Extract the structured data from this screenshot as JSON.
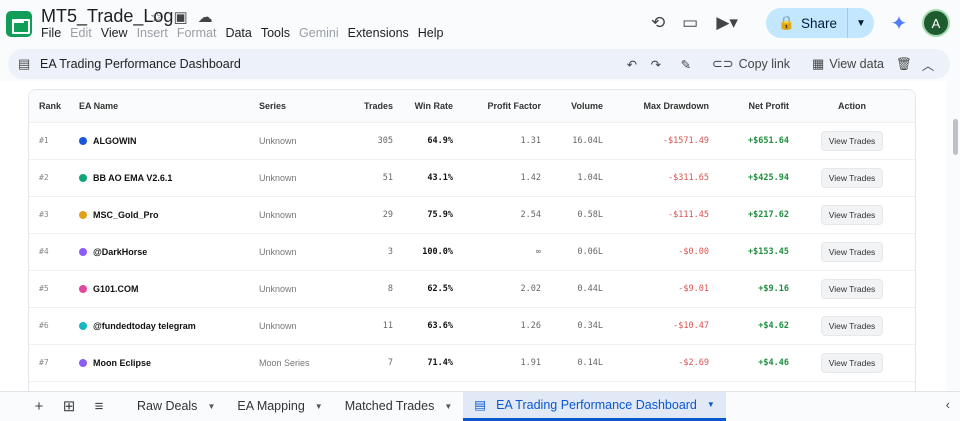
{
  "app": {
    "doc_title": "MT5_Trade_Log",
    "menu": [
      {
        "label": "File",
        "disabled": false
      },
      {
        "label": "Edit",
        "disabled": true
      },
      {
        "label": "View",
        "disabled": false
      },
      {
        "label": "Insert",
        "disabled": true
      },
      {
        "label": "Format",
        "disabled": true
      },
      {
        "label": "Data",
        "disabled": false
      },
      {
        "label": "Tools",
        "disabled": false
      },
      {
        "label": "Gemini",
        "disabled": true
      },
      {
        "label": "Extensions",
        "disabled": false
      },
      {
        "label": "Help",
        "disabled": false
      }
    ],
    "share_label": "Share",
    "avatar_initial": "A"
  },
  "dashboard": {
    "title": "EA Trading Performance Dashboard",
    "copy_link": "Copy link",
    "view_data": "View data"
  },
  "table": {
    "headers": [
      "Rank",
      "EA Name",
      "Series",
      "Trades",
      "Win Rate",
      "Profit Factor",
      "Volume",
      "Max Drawdown",
      "Net Profit",
      "Action"
    ],
    "rows": [
      {
        "rank": "#1",
        "name": "ALGOWIN",
        "color": "#1a56db",
        "series": "Unknown",
        "trades": "305",
        "win": "64.9%",
        "pf": "1.31",
        "vol": "16.04L",
        "dd": "-$1571.49",
        "np": "+$651.64",
        "action": "View Trades"
      },
      {
        "rank": "#2",
        "name": "BB AO EMA V2.6.1",
        "color": "#12a57a",
        "series": "Unknown",
        "trades": "51",
        "win": "43.1%",
        "pf": "1.42",
        "vol": "1.04L",
        "dd": "-$311.65",
        "np": "+$425.94",
        "action": "View Trades"
      },
      {
        "rank": "#3",
        "name": "MSC_Gold_Pro",
        "color": "#e0a017",
        "series": "Unknown",
        "trades": "29",
        "win": "75.9%",
        "pf": "2.54",
        "vol": "0.58L",
        "dd": "-$111.45",
        "np": "+$217.62",
        "action": "View Trades"
      },
      {
        "rank": "#4",
        "name": "@DarkHorse",
        "color": "#8b5cf6",
        "series": "Unknown",
        "trades": "3",
        "win": "100.0%",
        "pf": "∞",
        "vol": "0.06L",
        "dd": "-$0.00",
        "np": "+$153.45",
        "action": "View Trades"
      },
      {
        "rank": "#5",
        "name": "G101.COM",
        "color": "#e0479e",
        "series": "Unknown",
        "trades": "8",
        "win": "62.5%",
        "pf": "2.02",
        "vol": "0.44L",
        "dd": "-$9.01",
        "np": "+$9.16",
        "action": "View Trades"
      },
      {
        "rank": "#6",
        "name": "@fundedtoday telegram",
        "color": "#14b8c4",
        "series": "Unknown",
        "trades": "11",
        "win": "63.6%",
        "pf": "1.26",
        "vol": "0.34L",
        "dd": "-$10.47",
        "np": "+$4.62",
        "action": "View Trades"
      },
      {
        "rank": "#7",
        "name": "Moon Eclipse",
        "color": "#8b5cf6",
        "series": "Moon Series",
        "trades": "7",
        "win": "71.4%",
        "pf": "1.91",
        "vol": "0.14L",
        "dd": "-$2.69",
        "np": "+$4.46",
        "action": "View Trades"
      }
    ]
  },
  "tabs": {
    "items": [
      {
        "label": "Raw Deals",
        "active": false
      },
      {
        "label": "EA Mapping",
        "active": false
      },
      {
        "label": "Matched Trades",
        "active": false
      },
      {
        "label": "EA Trading Performance Dashboard",
        "active": true
      }
    ]
  }
}
